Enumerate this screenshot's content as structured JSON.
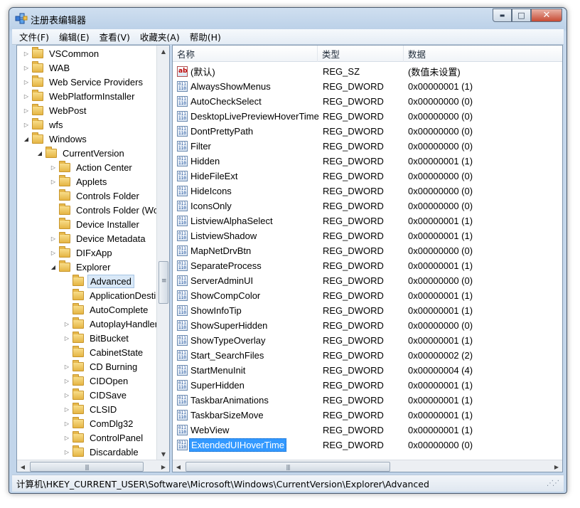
{
  "window": {
    "title": "注册表编辑器",
    "minimize_glyph": "▬",
    "maximize_glyph": "□",
    "close_glyph": "✕"
  },
  "menu": [
    "文件(F)",
    "编辑(E)",
    "查看(V)",
    "收藏夹(A)",
    "帮助(H)"
  ],
  "tree": [
    {
      "label": "VSCommon",
      "depth": 0,
      "expander": "collapsed"
    },
    {
      "label": "WAB",
      "depth": 0,
      "expander": "collapsed"
    },
    {
      "label": "Web Service Providers",
      "depth": 0,
      "expander": "collapsed"
    },
    {
      "label": "WebPlatformInstaller",
      "depth": 0,
      "expander": "collapsed"
    },
    {
      "label": "WebPost",
      "depth": 0,
      "expander": "collapsed"
    },
    {
      "label": "wfs",
      "depth": 0,
      "expander": "collapsed"
    },
    {
      "label": "Windows",
      "depth": 0,
      "expander": "expanded"
    },
    {
      "label": "CurrentVersion",
      "depth": 1,
      "expander": "expanded"
    },
    {
      "label": "Action Center",
      "depth": 2,
      "expander": "collapsed"
    },
    {
      "label": "Applets",
      "depth": 2,
      "expander": "collapsed"
    },
    {
      "label": "Controls Folder",
      "depth": 2,
      "expander": "none"
    },
    {
      "label": "Controls Folder (Wo",
      "depth": 2,
      "expander": "none"
    },
    {
      "label": "Device Installer",
      "depth": 2,
      "expander": "none"
    },
    {
      "label": "Device Metadata",
      "depth": 2,
      "expander": "collapsed"
    },
    {
      "label": "DIFxApp",
      "depth": 2,
      "expander": "collapsed"
    },
    {
      "label": "Explorer",
      "depth": 2,
      "expander": "expanded"
    },
    {
      "label": "Advanced",
      "depth": 3,
      "expander": "none",
      "selected": true
    },
    {
      "label": "ApplicationDestin",
      "depth": 3,
      "expander": "none"
    },
    {
      "label": "AutoComplete",
      "depth": 3,
      "expander": "none"
    },
    {
      "label": "AutoplayHandler",
      "depth": 3,
      "expander": "collapsed"
    },
    {
      "label": "BitBucket",
      "depth": 3,
      "expander": "collapsed"
    },
    {
      "label": "CabinetState",
      "depth": 3,
      "expander": "none"
    },
    {
      "label": "CD Burning",
      "depth": 3,
      "expander": "collapsed"
    },
    {
      "label": "CIDOpen",
      "depth": 3,
      "expander": "collapsed"
    },
    {
      "label": "CIDSave",
      "depth": 3,
      "expander": "collapsed"
    },
    {
      "label": "CLSID",
      "depth": 3,
      "expander": "collapsed"
    },
    {
      "label": "ComDlg32",
      "depth": 3,
      "expander": "collapsed"
    },
    {
      "label": "ControlPanel",
      "depth": 3,
      "expander": "collapsed"
    },
    {
      "label": "Discardable",
      "depth": 3,
      "expander": "collapsed"
    }
  ],
  "columns": {
    "name": "名称",
    "type": "类型",
    "data": "数据"
  },
  "values": [
    {
      "name": "(默认)",
      "type": "REG_SZ",
      "data": "(数值未设置)",
      "icon": "string-value-icon"
    },
    {
      "name": "AlwaysShowMenus",
      "type": "REG_DWORD",
      "data": "0x00000001 (1)",
      "icon": "binary-value-icon"
    },
    {
      "name": "AutoCheckSelect",
      "type": "REG_DWORD",
      "data": "0x00000000 (0)",
      "icon": "binary-value-icon"
    },
    {
      "name": "DesktopLivePreviewHoverTime",
      "type": "REG_DWORD",
      "data": "0x00000000 (0)",
      "icon": "binary-value-icon"
    },
    {
      "name": "DontPrettyPath",
      "type": "REG_DWORD",
      "data": "0x00000000 (0)",
      "icon": "binary-value-icon"
    },
    {
      "name": "Filter",
      "type": "REG_DWORD",
      "data": "0x00000000 (0)",
      "icon": "binary-value-icon"
    },
    {
      "name": "Hidden",
      "type": "REG_DWORD",
      "data": "0x00000001 (1)",
      "icon": "binary-value-icon"
    },
    {
      "name": "HideFileExt",
      "type": "REG_DWORD",
      "data": "0x00000000 (0)",
      "icon": "binary-value-icon"
    },
    {
      "name": "HideIcons",
      "type": "REG_DWORD",
      "data": "0x00000000 (0)",
      "icon": "binary-value-icon"
    },
    {
      "name": "IconsOnly",
      "type": "REG_DWORD",
      "data": "0x00000000 (0)",
      "icon": "binary-value-icon"
    },
    {
      "name": "ListviewAlphaSelect",
      "type": "REG_DWORD",
      "data": "0x00000001 (1)",
      "icon": "binary-value-icon"
    },
    {
      "name": "ListviewShadow",
      "type": "REG_DWORD",
      "data": "0x00000001 (1)",
      "icon": "binary-value-icon"
    },
    {
      "name": "MapNetDrvBtn",
      "type": "REG_DWORD",
      "data": "0x00000000 (0)",
      "icon": "binary-value-icon"
    },
    {
      "name": "SeparateProcess",
      "type": "REG_DWORD",
      "data": "0x00000001 (1)",
      "icon": "binary-value-icon"
    },
    {
      "name": "ServerAdminUI",
      "type": "REG_DWORD",
      "data": "0x00000000 (0)",
      "icon": "binary-value-icon"
    },
    {
      "name": "ShowCompColor",
      "type": "REG_DWORD",
      "data": "0x00000001 (1)",
      "icon": "binary-value-icon"
    },
    {
      "name": "ShowInfoTip",
      "type": "REG_DWORD",
      "data": "0x00000001 (1)",
      "icon": "binary-value-icon"
    },
    {
      "name": "ShowSuperHidden",
      "type": "REG_DWORD",
      "data": "0x00000000 (0)",
      "icon": "binary-value-icon"
    },
    {
      "name": "ShowTypeOverlay",
      "type": "REG_DWORD",
      "data": "0x00000001 (1)",
      "icon": "binary-value-icon"
    },
    {
      "name": "Start_SearchFiles",
      "type": "REG_DWORD",
      "data": "0x00000002 (2)",
      "icon": "binary-value-icon"
    },
    {
      "name": "StartMenuInit",
      "type": "REG_DWORD",
      "data": "0x00000004 (4)",
      "icon": "binary-value-icon"
    },
    {
      "name": "SuperHidden",
      "type": "REG_DWORD",
      "data": "0x00000001 (1)",
      "icon": "binary-value-icon"
    },
    {
      "name": "TaskbarAnimations",
      "type": "REG_DWORD",
      "data": "0x00000001 (1)",
      "icon": "binary-value-icon"
    },
    {
      "name": "TaskbarSizeMove",
      "type": "REG_DWORD",
      "data": "0x00000001 (1)",
      "icon": "binary-value-icon"
    },
    {
      "name": "WebView",
      "type": "REG_DWORD",
      "data": "0x00000001 (1)",
      "icon": "binary-value-icon"
    },
    {
      "name": "ExtendedUIHoverTime",
      "type": "REG_DWORD",
      "data": "0x00000000 (0)",
      "icon": "binary-value-icon",
      "selected": true
    }
  ],
  "status_path": "计算机\\HKEY_CURRENT_USER\\Software\\Microsoft\\Windows\\CurrentVersion\\Explorer\\Advanced",
  "colors": {
    "selection": "#3399ff",
    "tree_selection": "#d9e8f7",
    "frame": "#bcd1e8"
  }
}
